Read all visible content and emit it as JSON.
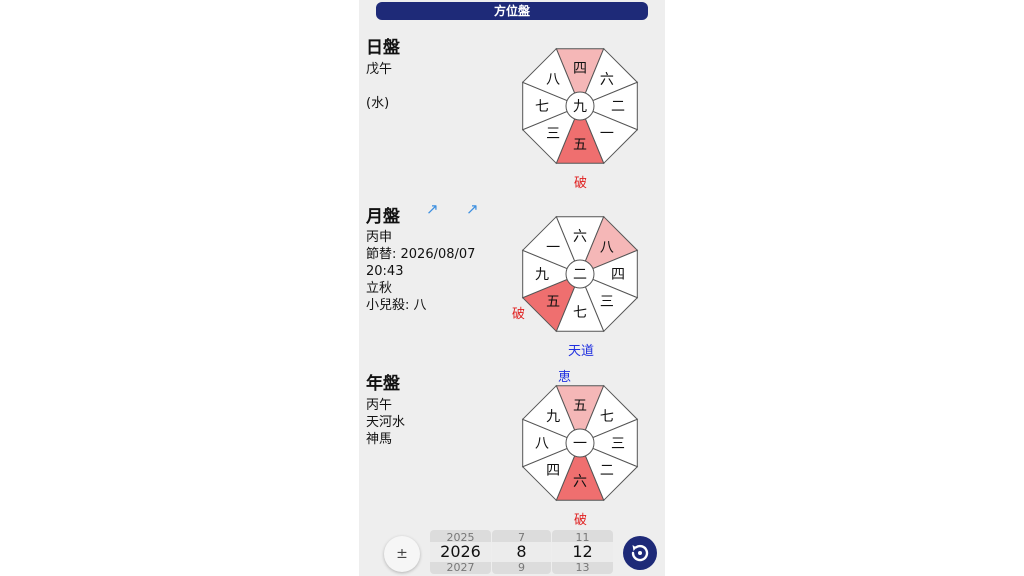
{
  "header": {
    "title": "方位盤"
  },
  "day": {
    "title": "日盤",
    "lines": [
      "戊午",
      "",
      "(水)"
    ],
    "board": {
      "center": "九",
      "n": "四",
      "ne": "六",
      "e": "二",
      "se": "一",
      "s": "五",
      "sw": "三",
      "w": "七",
      "nw": "八"
    },
    "tags": {
      "bottom": "破"
    }
  },
  "month": {
    "title": "月盤",
    "arrows": [
      "↗",
      "↗"
    ],
    "lines": [
      "丙申",
      "節替: 2026/08/07",
      "20:43",
      "立秋",
      "小兒殺: 八"
    ],
    "board": {
      "center": "二",
      "n": "六",
      "ne": "八",
      "e": "四",
      "se": "三",
      "s": "七",
      "sw": "五",
      "w": "九",
      "nw": "一"
    },
    "tags": {
      "left": "破",
      "bottom": "天道"
    }
  },
  "year": {
    "title": "年盤",
    "lines": [
      "丙午",
      "天河水",
      "神馬"
    ],
    "board": {
      "center": "一",
      "n": "五",
      "ne": "七",
      "e": "三",
      "se": "二",
      "s": "六",
      "sw": "四",
      "w": "八",
      "nw": "九"
    },
    "tags": {
      "top": "恵",
      "bottom": "破"
    }
  },
  "colors": {
    "accent": "#1e2a78",
    "highlight_light": "#f5b7b7",
    "highlight_dark": "#ef6f6f",
    "arrow": "#3c8fe0",
    "red_text": "#e02020",
    "blue_text": "#2030e0"
  },
  "controls": {
    "plusminus": "±",
    "year_picker": {
      "prev": "2025",
      "current": "2026",
      "next": "2027"
    },
    "month_picker": {
      "prev": "7",
      "current": "8",
      "next": "9"
    },
    "day_picker": {
      "prev": "11",
      "current": "12",
      "next": "13"
    },
    "reset_icon": "reset-icon"
  }
}
